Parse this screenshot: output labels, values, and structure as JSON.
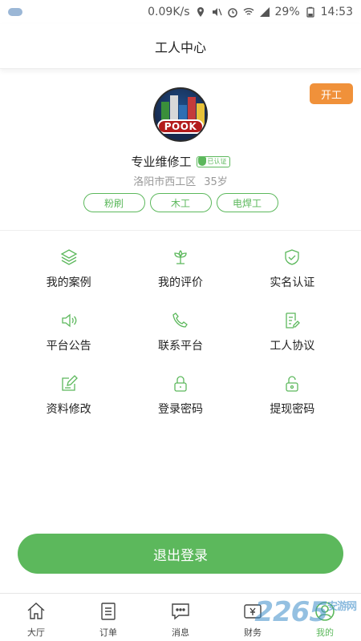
{
  "status_bar": {
    "speed": "0.09K/s",
    "battery": "29%",
    "time": "14:53"
  },
  "header": {
    "title": "工人中心"
  },
  "profile": {
    "work_button": "开工",
    "logo_text": "POOK",
    "name": "专业维修工",
    "verified_label": "已认证",
    "location": "洛阳市西工区",
    "age": "35岁",
    "tags": [
      "粉刷",
      "木工",
      "电焊工"
    ]
  },
  "menu": [
    {
      "label": "我的案例",
      "icon": "layers-icon"
    },
    {
      "label": "我的评价",
      "icon": "flower-icon"
    },
    {
      "label": "实名认证",
      "icon": "shield-check-icon"
    },
    {
      "label": "平台公告",
      "icon": "speaker-icon"
    },
    {
      "label": "联系平台",
      "icon": "phone-icon"
    },
    {
      "label": "工人协议",
      "icon": "document-edit-icon"
    },
    {
      "label": "资料修改",
      "icon": "edit-square-icon"
    },
    {
      "label": "登录密码",
      "icon": "lock-icon"
    },
    {
      "label": "提现密码",
      "icon": "unlock-icon"
    }
  ],
  "logout_label": "退出登录",
  "tabs": [
    {
      "label": "大厅",
      "icon": "home-icon",
      "active": false
    },
    {
      "label": "订单",
      "icon": "list-icon",
      "active": false
    },
    {
      "label": "消息",
      "icon": "message-icon",
      "active": false
    },
    {
      "label": "财务",
      "icon": "wallet-icon",
      "active": false
    },
    {
      "label": "我的",
      "icon": "user-icon",
      "active": true
    }
  ],
  "watermark": {
    "text": "2265",
    "sub": "安游网"
  },
  "colors": {
    "accent_green": "#5cb85c",
    "work_orange": "#f0913a"
  }
}
